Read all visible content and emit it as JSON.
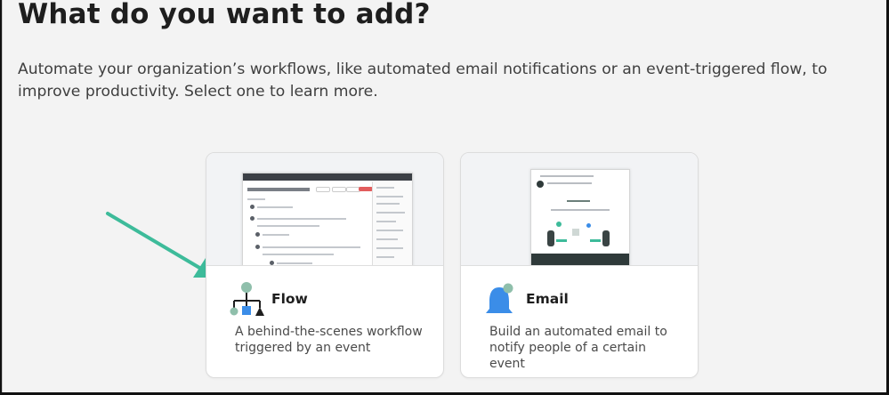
{
  "header": {
    "title": "What do you want to add?",
    "description": "Automate your organization’s workflows, like automated email notifications or an event-triggered flow, to improve productivity. Select one to learn more."
  },
  "cards": [
    {
      "title": "Flow",
      "description": "A behind-the-scenes workflow triggered by an event",
      "icon": "flow-diagram-icon"
    },
    {
      "title": "Email",
      "description": "Build an automated email to notify people of a certain event",
      "icon": "bell-icon"
    }
  ],
  "colors": {
    "accent_teal": "#3dbb9a",
    "icon_blue": "#3b8de8",
    "icon_green": "#8fbfab",
    "icon_dark": "#1e1e1e",
    "background": "#f3f3f3"
  }
}
